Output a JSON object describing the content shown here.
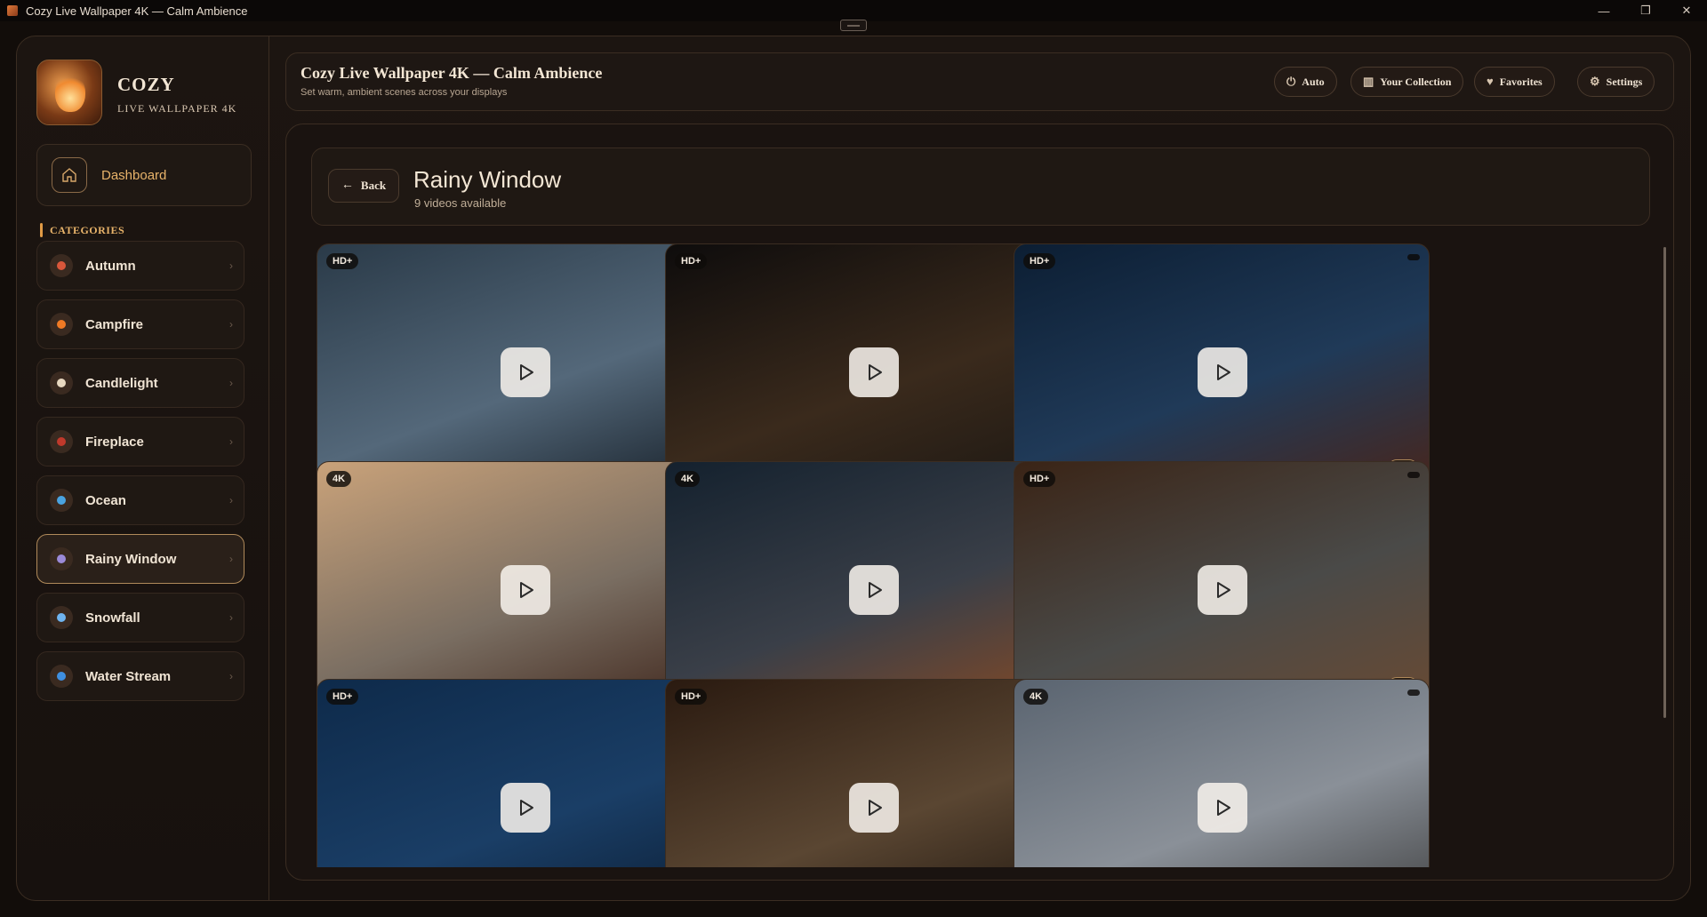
{
  "window": {
    "title": "Cozy Live Wallpaper 4K — Calm Ambience",
    "controls": [
      "—",
      "❐",
      "✕"
    ]
  },
  "brand": {
    "name": "COZY",
    "subtitle": "LIVE WALLPAPER 4K"
  },
  "sidebar": {
    "dashboard_label": "Dashboard",
    "categories_heading": "CATEGORIES",
    "categories": [
      {
        "label": "Autumn",
        "icon": "leaf-icon",
        "color": "#d9573b"
      },
      {
        "label": "Campfire",
        "icon": "flame-icon",
        "color": "#f07a24"
      },
      {
        "label": "Candlelight",
        "icon": "candle-icon",
        "color": "#e8d8c0"
      },
      {
        "label": "Fireplace",
        "icon": "fireplace-icon",
        "color": "#c0392b"
      },
      {
        "label": "Ocean",
        "icon": "wave-icon",
        "color": "#4aa3e0"
      },
      {
        "label": "Rainy Window",
        "icon": "cloud-icon",
        "color": "#9b8ad8",
        "active": true
      },
      {
        "label": "Snowfall",
        "icon": "snowflake-icon",
        "color": "#6fb4f0"
      },
      {
        "label": "Water Stream",
        "icon": "droplet-icon",
        "color": "#3f8fe0"
      }
    ]
  },
  "header": {
    "title": "Cozy Live Wallpaper 4K — Calm Ambience",
    "subtitle": "Set warm, ambient scenes across your displays",
    "buttons": [
      {
        "label": "Auto",
        "icon": "power-icon"
      },
      {
        "label": "Your Collection",
        "icon": "library-icon"
      },
      {
        "label": "Favorites",
        "icon": "heart-icon"
      },
      {
        "label": "Settings",
        "icon": "gear-icon"
      }
    ]
  },
  "category_view": {
    "back_label": "Back",
    "title": "Rainy Window",
    "count_text": "9 videos available"
  },
  "videos": [
    {
      "badge": "HD+",
      "scene": "rain-on-glass",
      "colors": [
        "#2a3a48",
        "#54687a",
        "#121a22"
      ]
    },
    {
      "badge": "HD+",
      "scene": "night-skyscrapers",
      "colors": [
        "#0e0c0c",
        "#3a2a1c",
        "#1a1612"
      ]
    },
    {
      "badge": "HD+",
      "scene": "bedroom-city-view",
      "colors": [
        "#0c1e33",
        "#203a58",
        "#4a2418"
      ]
    },
    {
      "badge": "4K",
      "scene": "window-flowers",
      "colors": [
        "#c9a27a",
        "#7a6e62",
        "#3a2016"
      ]
    },
    {
      "badge": "4K",
      "scene": "rainy-city-aerial",
      "colors": [
        "#14212e",
        "#3a3f48",
        "#8a4a22"
      ]
    },
    {
      "badge": "HD+",
      "scene": "cabin-living-room",
      "colors": [
        "#3a2416",
        "#4a4a48",
        "#6a4a32"
      ]
    },
    {
      "badge": "HD+",
      "scene": "blue-rain-night",
      "colors": [
        "#0e2a4a",
        "#1a3e66",
        "#0a1a2e"
      ]
    },
    {
      "badge": "HD+",
      "scene": "wooden-lantern-room",
      "colors": [
        "#2a1a10",
        "#5a4632",
        "#1a120c"
      ]
    },
    {
      "badge": "4K",
      "scene": "snowy-rooftops",
      "colors": [
        "#5a6470",
        "#8a9098",
        "#3a3a3a"
      ]
    }
  ]
}
